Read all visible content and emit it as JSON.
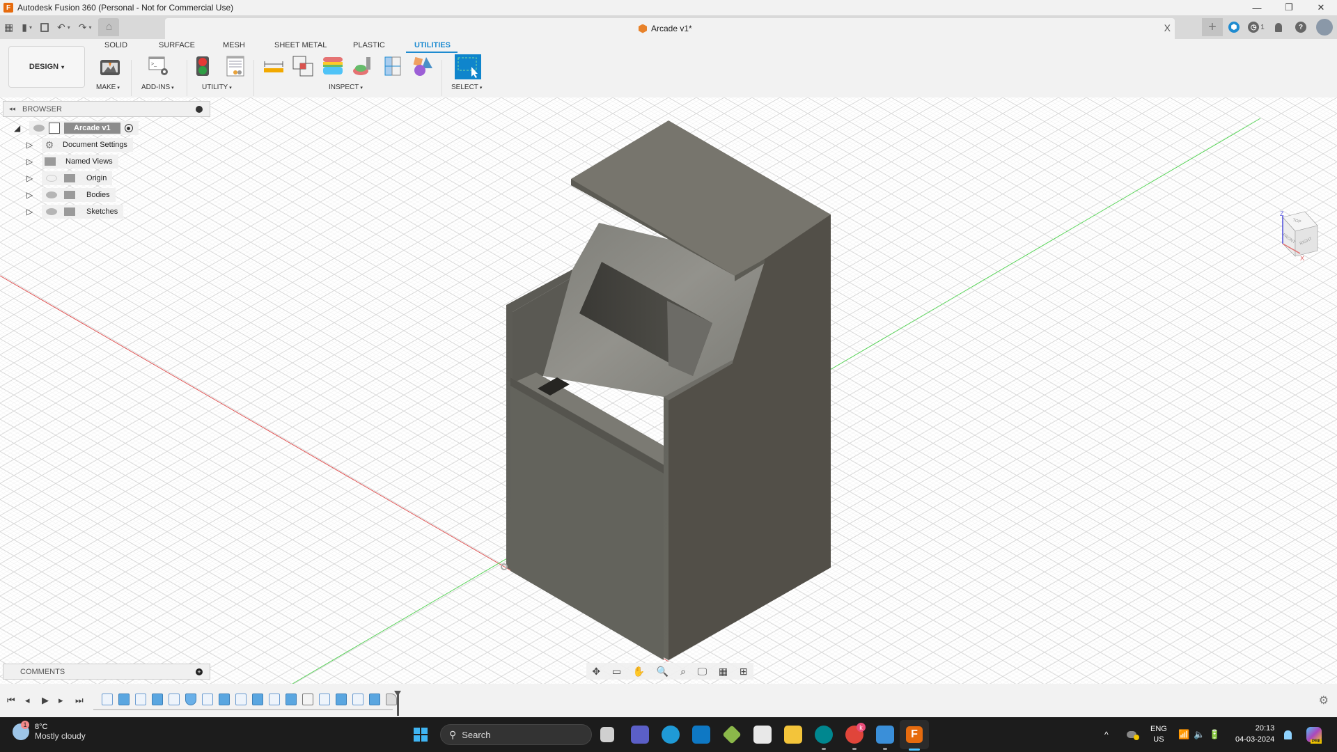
{
  "window": {
    "title": "Autodesk Fusion 360 (Personal - Not for Commercial Use)",
    "app_icon": "fusion-360-logo",
    "controls": {
      "minimize": "—",
      "restore": "❐",
      "close": "✕"
    }
  },
  "quick_access": {
    "grid_icon": "▦",
    "file_icon": "▮",
    "save_icon": "💾",
    "undo_icon": "↶",
    "redo_icon": "↷",
    "home_icon": "⌂",
    "dropdown_glyph": "▾"
  },
  "document_tab": {
    "name": "Arcade v1*",
    "close_glyph": "X"
  },
  "top_right": {
    "new_tab_glyph": "+",
    "extensions_glyph": "⬢",
    "job_status_count": "1",
    "job_status_glyph": "◷",
    "notifications_glyph": "🔔",
    "help_glyph": "?"
  },
  "ribbon": {
    "workspace": "DESIGN",
    "tabs": [
      {
        "label": "SOLID",
        "active": false
      },
      {
        "label": "SURFACE",
        "active": false
      },
      {
        "label": "MESH",
        "active": false
      },
      {
        "label": "SHEET METAL",
        "active": false
      },
      {
        "label": "PLASTIC",
        "active": false
      },
      {
        "label": "UTILITIES",
        "active": true
      }
    ],
    "groups": [
      {
        "label": "MAKE"
      },
      {
        "label": "ADD-INS"
      },
      {
        "label": "UTILITY"
      },
      {
        "label": "INSPECT"
      },
      {
        "label": "SELECT"
      }
    ],
    "dropdown_glyph": "▾",
    "accent_color": "#1e8bd0"
  },
  "browser": {
    "title": "BROWSER",
    "collapse_glyph": "◂◂",
    "root": {
      "label": "Arcade v1"
    },
    "items": [
      {
        "label": "Document Settings",
        "icon": "gear-icon",
        "visible": null
      },
      {
        "label": "Named Views",
        "icon": "folder-icon",
        "visible": null
      },
      {
        "label": "Origin",
        "icon": "folder-icon",
        "visible": false
      },
      {
        "label": "Bodies",
        "icon": "folder-icon",
        "visible": true
      },
      {
        "label": "Sketches",
        "icon": "folder-icon",
        "visible": true
      }
    ]
  },
  "comments": {
    "title": "COMMENTS",
    "add_glyph": "+"
  },
  "viewcube": {
    "faces": {
      "top": "TOP",
      "front": "FRONT",
      "right": "RIGHT"
    },
    "axes": {
      "z": "Z",
      "x": "X"
    }
  },
  "nav_toolbar": {
    "orbit": "✥",
    "look_at": "▭",
    "pan": "✋",
    "zoom": "🔍",
    "fit": "⌕",
    "display": "🖵",
    "grid": "▦",
    "viewports": "⊞",
    "dropdown_glyph": "▾"
  },
  "timeline": {
    "controls": {
      "first": "⏮",
      "prev": "◂",
      "play": "▶",
      "next": "▸",
      "last": "⏭"
    },
    "features": [
      "sketch",
      "extrude",
      "sketch",
      "extrude",
      "sketch",
      "loft",
      "sketch",
      "extrude",
      "sketch",
      "extrude",
      "sketch",
      "extrude",
      "shell",
      "sketch",
      "extrude",
      "sketch",
      "extrude",
      "fillet"
    ],
    "settings_glyph": "⚙"
  },
  "taskbar": {
    "weather": {
      "temp": "8°C",
      "condition": "Mostly cloudy",
      "badge": "1"
    },
    "search_label": "Search",
    "search_glyph": "⚲",
    "tray": {
      "chevron": "^",
      "lang_top": "ENG",
      "lang_bottom": "US",
      "wifi": "📶",
      "volume": "🔈",
      "battery": "🔋",
      "time": "20:13",
      "date": "04-03-2024",
      "bell": "🔔",
      "copilot_badge": "PRE"
    },
    "chrome_badge": "k"
  }
}
